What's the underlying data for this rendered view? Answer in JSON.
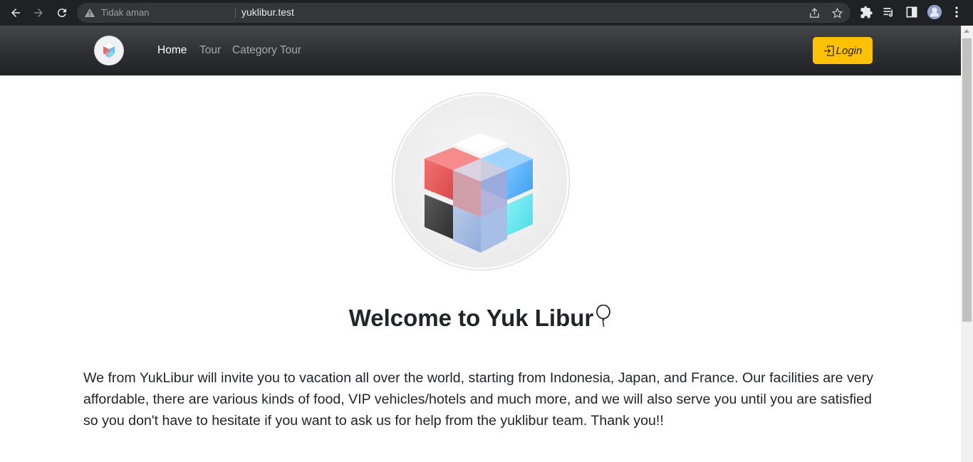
{
  "browser": {
    "security_text": "Tidak aman",
    "url": "yuklibur.test"
  },
  "nav": {
    "links": [
      "Home",
      "Tour",
      "Category Tour"
    ],
    "active_index": 0,
    "login_label": "Login"
  },
  "hero": {
    "title": "Welcome to Yuk Libur",
    "title_icon": "balloon-icon",
    "description": "We from YukLibur will invite you to vacation all over the world, starting from Indonesia, Japan, and France. Our facilities are very affordable, there are various kinds of food, VIP vehicles/hotels and much more, and we will also serve you until you are satisfied so you don't have to hesitate if you want to ask us for help from the yuklibur team. Thank you!!"
  },
  "colors": {
    "login_button": "#ffc107",
    "nav_active": "#ffffff",
    "nav_inactive": "#a6a8ab"
  }
}
